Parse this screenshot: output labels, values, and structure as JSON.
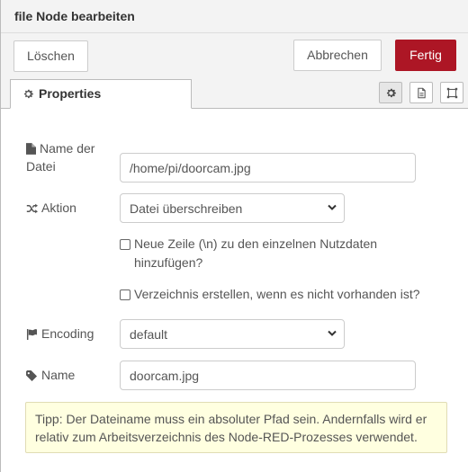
{
  "header": {
    "title": "file Node bearbeiten"
  },
  "toolbar": {
    "delete_label": "Löschen",
    "cancel_label": "Abbrechen",
    "done_label": "Fertig",
    "done_color": "#ad1625"
  },
  "tabs": {
    "properties_label": "Properties",
    "properties_icon": "gear-icon",
    "icon_tabs": [
      "gear-icon",
      "document-icon",
      "appearance-icon"
    ]
  },
  "form": {
    "filename": {
      "label_line1": "Name der",
      "label_line2": "Datei",
      "icon": "file-icon",
      "value": "/home/pi/doorcam.jpg"
    },
    "action": {
      "label": "Aktion",
      "icon": "shuffle-icon",
      "selected": "Datei überschreiben"
    },
    "append_newline": {
      "label_line1": "Neue Zeile (\\n) zu den einzelnen Nutzdaten",
      "label_line2": "hinzufügen?",
      "checked": false
    },
    "create_dir": {
      "label": "Verzeichnis erstellen, wenn es nicht vorhanden ist?",
      "checked": false
    },
    "encoding": {
      "label": "Encoding",
      "icon": "flag-icon",
      "selected": "default"
    },
    "name": {
      "label": "Name",
      "icon": "tag-icon",
      "value": "doorcam.jpg"
    }
  },
  "tip": {
    "line1": "Tipp: Der Dateiname muss ein absoluter Pfad sein. Andernfalls wird er",
    "line2": "relativ zum Arbeitsverzeichnis des Node-RED-Prozesses verwendet."
  }
}
